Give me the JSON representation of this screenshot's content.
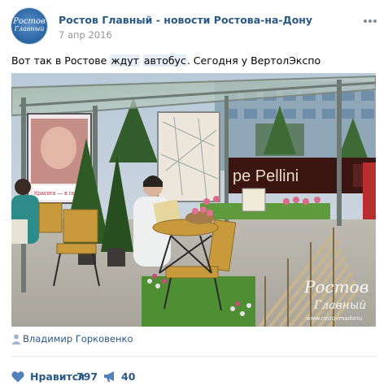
{
  "post": {
    "group_name": "Ростов Главный - новости Ростова-на-Дону",
    "date": "7 апр 2016",
    "text_parts": [
      "Вот так в Ростове ",
      "ждут",
      " ",
      "автобус",
      ". Сегодня у ВертолЭкспо"
    ],
    "avatar_text": [
      "Ростов",
      "Главный"
    ]
  },
  "photo": {
    "poster_text": "Красота — в гармонии",
    "sign_text": "pe Pellini",
    "watermark_line1": "Ростов",
    "watermark_line2": "Главный",
    "watermark_url": "www.rostovmadonu"
  },
  "author": {
    "name": "Владимир Горковенко"
  },
  "actions": {
    "like_label": "Нравится",
    "like_count": "797",
    "share_count": "40"
  },
  "icons": {
    "menu": "more-dots-icon",
    "author": "author-person-icon",
    "like": "heart-icon",
    "share": "megaphone-icon"
  },
  "colors": {
    "link": "#2a5885",
    "date": "#939393",
    "icon": "#5181b8"
  }
}
